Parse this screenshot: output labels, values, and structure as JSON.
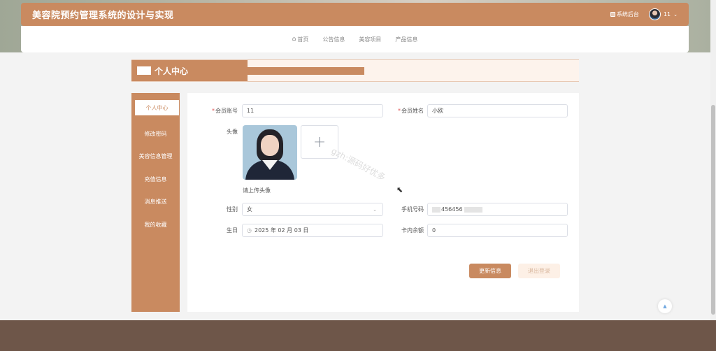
{
  "header": {
    "site_title": "美容院预约管理系统的设计与实现",
    "admin_link": "系统后台",
    "username": "11",
    "chevron": "⌄"
  },
  "nav": {
    "items": [
      "首页",
      "公告信息",
      "美容项目",
      "产品信息"
    ]
  },
  "banner": {
    "title": "个人中心"
  },
  "sidebar": {
    "items": [
      {
        "label": "个人中心",
        "active": true
      },
      {
        "label": "修改密码"
      },
      {
        "label": "美容信息管理"
      },
      {
        "label": "充值信息"
      },
      {
        "label": "消息推送"
      },
      {
        "label": "我的收藏"
      }
    ]
  },
  "form": {
    "account_label": "会员账号",
    "account_value": "11",
    "name_label": "会员姓名",
    "name_value": "小欧",
    "avatar_label": "头像",
    "upload_plus": "+",
    "upload_tip": "请上传头像",
    "gender_label": "性别",
    "gender_value": "女",
    "phone_label": "手机号码",
    "phone_value": "456456",
    "birthday_label": "生日",
    "birthday_value": "2025 年 02 月 03 日",
    "balance_label": "卡内余额",
    "balance_value": "0",
    "required_mark": "*"
  },
  "buttons": {
    "update": "更新信息",
    "logout": "退出登录"
  },
  "watermark": "gzh:源码好优多",
  "icons": {
    "home": "home-icon",
    "admin": "copy-icon",
    "clock": "clock-icon",
    "back_top": "caret-up-icon"
  },
  "colors": {
    "primary": "#c98a60",
    "banner_bg": "#fdf3ec",
    "footer": "#6e5649"
  }
}
